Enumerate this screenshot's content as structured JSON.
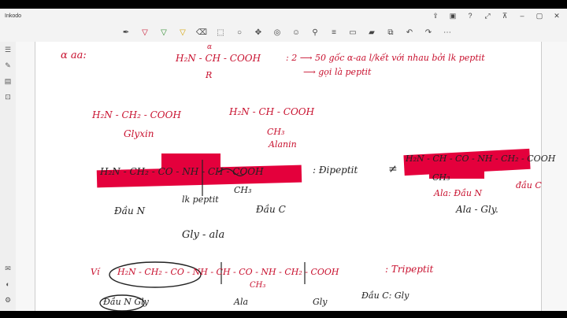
{
  "window": {
    "title": "Inkodo"
  },
  "notes": {
    "alpha_label": "α aa:",
    "structure_top": "H₂N - CH - COOH",
    "alpha_mark": "α",
    "r_group": "R",
    "formation_rule": ": 2 ⟶ 50 gốc α-aa l/kết với nhau bởi lk peptit",
    "called_peptide": "⟶ gọi là peptit",
    "glycine_formula": "H₂N - CH₂ - COOH",
    "glycine_name": "Glyxin",
    "alanine_formula": "H₂N - CH - COOH",
    "alanine_ch3": "CH₃",
    "alanine_name": "Alanin",
    "dipeptide_formula": "H₂N - CH₂ - CO - NH - CH - COOH",
    "dipeptide_ch3": "CH₃",
    "dipeptide_label": ": Đipeptit",
    "not_equal": "≠",
    "peptide_bond_label": "lk peptit",
    "n_terminal": "Đầu N",
    "c_terminal": "Đầu C",
    "gly_ala": "Gly - ala",
    "alt_formula": "H₂N - CH - CO - NH - CH₂ - COOH",
    "alt_ch3": "CH₃",
    "ala_n_terminal": "Ala: Đầu N",
    "alt_c_terminal": "đầu C",
    "ala_gly": "Ala - Gly.",
    "example_mark": "Ví",
    "tripeptide_formula": "H₂N - CH₂ - CO - NH - CH - CO - NH - CH₂ - COOH",
    "tripeptide_label": ": Tripeptit",
    "tripeptide_ch3": "CH₃",
    "tri_n": "Đầu N Gly",
    "tri_ala": "Ala",
    "tri_gly": "Gly",
    "tri_c": "Đầu C: Gly"
  }
}
